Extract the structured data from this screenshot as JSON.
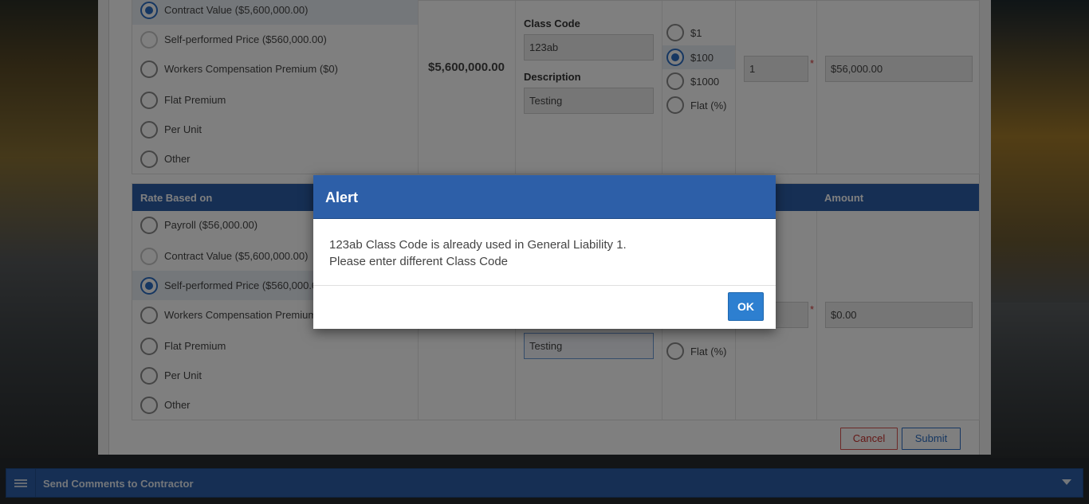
{
  "section1": {
    "options": [
      {
        "label": "Contract Value ($5,600,000.00)",
        "checked": true
      },
      {
        "label": "Self-performed Price ($560,000.00)",
        "checked": false
      },
      {
        "label": "Workers Compensation Premium ($0)",
        "checked": false
      },
      {
        "label": "Flat Premium",
        "checked": false
      },
      {
        "label": "Per Unit",
        "checked": false
      },
      {
        "label": "Other",
        "checked": false
      }
    ],
    "basis_value": "$5,600,000.00",
    "class_code_label": "Class Code",
    "class_code_value": "123ab",
    "description_label": "Description",
    "description_value": "Testing",
    "rates": [
      {
        "label": "$1",
        "checked": false
      },
      {
        "label": "$100",
        "checked": true
      },
      {
        "label": "$1000",
        "checked": false
      },
      {
        "label": "Flat (%)",
        "checked": false
      }
    ],
    "rate_input": "1",
    "amount": "$56,000.00"
  },
  "section2": {
    "header_rate_based_on": "Rate Based on",
    "header_amount": "Amount",
    "options": [
      {
        "label": "Payroll ($56,000.00)",
        "checked": false
      },
      {
        "label": "Contract Value ($5,600,000.00)",
        "checked": false
      },
      {
        "label": "Self-performed Price ($560,000.00)",
        "checked": true
      },
      {
        "label": "Workers Compensation Premium ($",
        "checked": false
      },
      {
        "label": "Flat Premium",
        "checked": false
      },
      {
        "label": "Per Unit",
        "checked": false
      },
      {
        "label": "Other",
        "checked": false
      }
    ],
    "description_value": "Testing",
    "rate_flat": "Flat (%)",
    "amount": "$0.00",
    "cancel_label": "Cancel",
    "submit_label": "Submit"
  },
  "footer": {
    "title": "Send Comments to Contractor"
  },
  "modal": {
    "title": "Alert",
    "message_line1": "123ab Class Code is already used in General Liability 1.",
    "message_line2": "Please enter different Class Code",
    "ok_label": "OK"
  },
  "colors": {
    "primary": "#2d5fa8",
    "accent": "#2d6fc4",
    "danger": "#d9534f"
  }
}
